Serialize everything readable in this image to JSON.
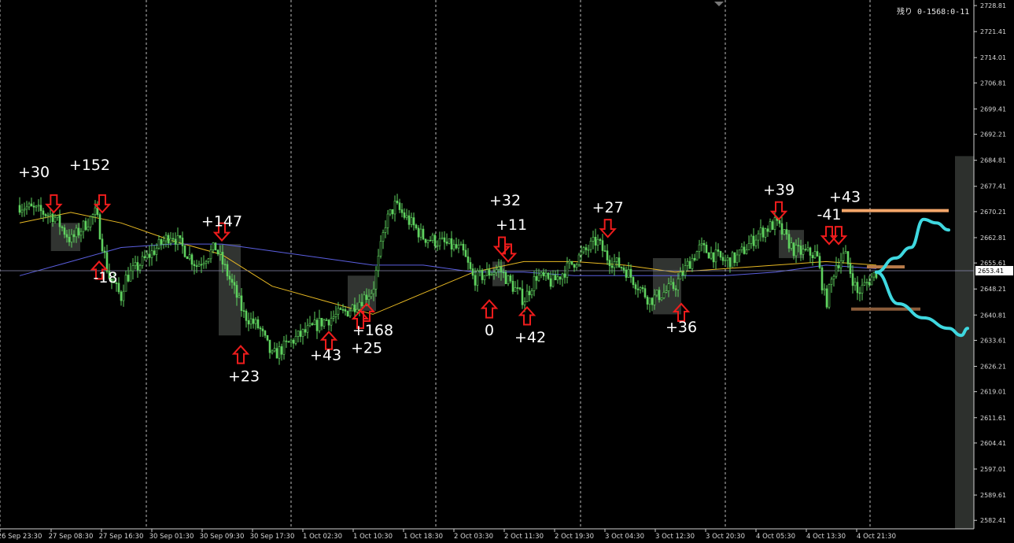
{
  "chart_data": {
    "type": "candlestick",
    "title": "",
    "xlabel": "",
    "ylabel": "",
    "ylim": [
      2580.0,
      2729.5
    ],
    "grid": "vertical-dashed",
    "y_ticks": [
      "2728.81",
      "2721.41",
      "2714.01",
      "2706.81",
      "2699.41",
      "2692.21",
      "2684.81",
      "2677.41",
      "2670.21",
      "2662.81",
      "2655.61",
      "2648.21",
      "2640.81",
      "2633.61",
      "2626.21",
      "2619.01",
      "2611.61",
      "2604.41",
      "2597.01",
      "2589.61",
      "2582.41"
    ],
    "x_ticks": [
      "26 Sep 23:30",
      "27 Sep 08:30",
      "27 Sep 16:30",
      "30 Sep 01:30",
      "30 Sep 09:30",
      "30 Sep 17:30",
      "1 Oct 02:30",
      "1 Oct 10:30",
      "1 Oct 18:30",
      "2 Oct 03:30",
      "2 Oct 11:30",
      "2 Oct 19:30",
      "3 Oct 04:30",
      "3 Oct 12:30",
      "3 Oct 20:30",
      "4 Oct 05:30",
      "4 Oct 13:30",
      "4 Oct 21:30"
    ],
    "current_price": "2653.41",
    "countdown": "残り 0-1568:0-11",
    "price_path": [
      [
        "26 Sep 23:30",
        2672
      ],
      [
        "27 Sep 05:30",
        2669
      ],
      [
        "27 Sep 08:30",
        2662
      ],
      [
        "27 Sep 12:30",
        2670
      ],
      [
        "27 Sep 14:30",
        2652
      ],
      [
        "27 Sep 16:30",
        2646
      ],
      [
        "27 Sep 20:30",
        2651
      ],
      [
        "30 Sep 01:30",
        2664
      ],
      [
        "30 Sep 05:30",
        2655
      ],
      [
        "30 Sep 08:30",
        2660
      ],
      [
        "30 Sep 11:00",
        2650
      ],
      [
        "30 Sep 13:00",
        2641
      ],
      [
        "30 Sep 15:30",
        2637
      ],
      [
        "30 Sep 17:30",
        2629
      ],
      [
        "30 Sep 21:30",
        2634
      ],
      [
        "1 Oct 02:30",
        2639
      ],
      [
        "1 Oct 06:30",
        2642
      ],
      [
        "1 Oct 10:30",
        2648
      ],
      [
        "1 Oct 12:30",
        2667
      ],
      [
        "1 Oct 14:00",
        2672
      ],
      [
        "1 Oct 18:30",
        2663
      ],
      [
        "1 Oct 22:30",
        2661
      ],
      [
        "2 Oct 01:30",
        2659
      ],
      [
        "2 Oct 03:30",
        2651
      ],
      [
        "2 Oct 07:30",
        2654
      ],
      [
        "2 Oct 11:30",
        2645
      ],
      [
        "2 Oct 13:30",
        2652
      ],
      [
        "2 Oct 16:00",
        2650
      ],
      [
        "2 Oct 19:30",
        2656
      ],
      [
        "2 Oct 23:30",
        2662
      ],
      [
        "3 Oct 01:30",
        2657
      ],
      [
        "3 Oct 04:30",
        2654
      ],
      [
        "3 Oct 08:30",
        2645
      ],
      [
        "3 Oct 12:30",
        2649
      ],
      [
        "3 Oct 14:30",
        2655
      ],
      [
        "3 Oct 16:30",
        2660
      ],
      [
        "3 Oct 20:30",
        2656
      ],
      [
        "3 Oct 22:30",
        2657
      ],
      [
        "4 Oct 02:30",
        2664
      ],
      [
        "4 Oct 05:30",
        2667
      ],
      [
        "4 Oct 08:30",
        2659
      ],
      [
        "4 Oct 12:00",
        2658
      ],
      [
        "4 Oct 13:30",
        2644
      ],
      [
        "4 Oct 15:00",
        2655
      ],
      [
        "4 Oct 16:30",
        2658
      ],
      [
        "4 Oct 18:30",
        2647
      ],
      [
        "4 Oct 21:30",
        2653
      ]
    ],
    "series": [
      {
        "name": "",
        "color": "#e8b923",
        "values": [
          [
            "26 Sep 23:30",
            2667
          ],
          [
            "27 Sep 08:30",
            2670
          ],
          [
            "27 Sep 16:30",
            2667
          ],
          [
            "30 Sep 01:30",
            2662
          ],
          [
            "30 Sep 09:30",
            2658
          ],
          [
            "30 Sep 17:30",
            2649
          ],
          [
            "1 Oct 02:30",
            2645
          ],
          [
            "1 Oct 10:30",
            2641
          ],
          [
            "1 Oct 18:30",
            2647
          ],
          [
            "2 Oct 03:30",
            2653
          ],
          [
            "2 Oct 11:30",
            2656
          ],
          [
            "2 Oct 19:30",
            2656
          ],
          [
            "3 Oct 04:30",
            2655
          ],
          [
            "3 Oct 12:30",
            2653
          ],
          [
            "3 Oct 20:30",
            2654
          ],
          [
            "4 Oct 05:30",
            2655
          ],
          [
            "4 Oct 13:30",
            2656
          ],
          [
            "4 Oct 21:30",
            2655
          ]
        ]
      },
      {
        "name": "",
        "color": "#5b5fe0",
        "values": [
          [
            "26 Sep 23:30",
            2652
          ],
          [
            "27 Sep 08:30",
            2656
          ],
          [
            "27 Sep 16:30",
            2660
          ],
          [
            "30 Sep 01:30",
            2661
          ],
          [
            "30 Sep 09:30",
            2661
          ],
          [
            "30 Sep 17:30",
            2659
          ],
          [
            "1 Oct 02:30",
            2657
          ],
          [
            "1 Oct 10:30",
            2655
          ],
          [
            "1 Oct 18:30",
            2655
          ],
          [
            "2 Oct 03:30",
            2653
          ],
          [
            "2 Oct 11:30",
            2653
          ],
          [
            "2 Oct 19:30",
            2652
          ],
          [
            "3 Oct 04:30",
            2652
          ],
          [
            "3 Oct 12:30",
            2652
          ],
          [
            "3 Oct 20:30",
            2652
          ],
          [
            "4 Oct 05:30",
            2653
          ],
          [
            "4 Oct 13:30",
            2655
          ],
          [
            "4 Oct 21:30",
            2654
          ]
        ]
      }
    ],
    "arrows": [
      {
        "dir": "down",
        "x": "27 Sep 05:30",
        "price": 2670
      },
      {
        "dir": "down",
        "x": "27 Sep 13:30",
        "price": 2670
      },
      {
        "dir": "up",
        "x": "27 Sep 13:00",
        "price": 2656
      },
      {
        "dir": "down",
        "x": "30 Sep 09:30",
        "price": 2662
      },
      {
        "dir": "up",
        "x": "30 Sep 12:30",
        "price": 2632
      },
      {
        "dir": "up",
        "x": "1 Oct 03:30",
        "price": 2636
      },
      {
        "dir": "up",
        "x": "1 Oct 08:30",
        "price": 2642
      },
      {
        "dir": "up",
        "x": "1 Oct 09:30",
        "price": 2644
      },
      {
        "dir": "up",
        "x": "2 Oct 06:00",
        "price": 2645
      },
      {
        "dir": "down",
        "x": "2 Oct 08:00",
        "price": 2658
      },
      {
        "dir": "down",
        "x": "2 Oct 09:00",
        "price": 2656
      },
      {
        "dir": "up",
        "x": "2 Oct 12:00",
        "price": 2643
      },
      {
        "dir": "down",
        "x": "3 Oct 01:30",
        "price": 2663
      },
      {
        "dir": "up",
        "x": "3 Oct 13:30",
        "price": 2644
      },
      {
        "dir": "down",
        "x": "4 Oct 06:00",
        "price": 2668
      },
      {
        "dir": "down",
        "x": "4 Oct 14:00",
        "price": 2661
      },
      {
        "dir": "down",
        "x": "4 Oct 15:30",
        "price": 2661
      }
    ],
    "annotations": [
      {
        "text": "+30",
        "x": "27 Sep 02:00",
        "price": 2680
      },
      {
        "text": "+152",
        "x": "27 Sep 11:30",
        "price": 2682
      },
      {
        "text": "-18",
        "x": "27 Sep 14:00",
        "price": 2650
      },
      {
        "text": "+147",
        "x": "30 Sep 09:30",
        "price": 2666
      },
      {
        "text": "+23",
        "x": "30 Sep 13:00",
        "price": 2622
      },
      {
        "text": "+43",
        "x": "1 Oct 03:00",
        "price": 2628
      },
      {
        "text": "+168",
        "x": "1 Oct 10:30",
        "price": 2635
      },
      {
        "text": "+25",
        "x": "1 Oct 09:30",
        "price": 2630
      },
      {
        "text": "+32",
        "x": "2 Oct 08:30",
        "price": 2672
      },
      {
        "text": "+11",
        "x": "2 Oct 09:30",
        "price": 2665
      },
      {
        "text": "0",
        "x": "2 Oct 06:00",
        "price": 2635
      },
      {
        "text": "+42",
        "x": "2 Oct 12:30",
        "price": 2633
      },
      {
        "text": "+27",
        "x": "3 Oct 01:30",
        "price": 2670
      },
      {
        "text": "+36",
        "x": "3 Oct 13:30",
        "price": 2636
      },
      {
        "text": "+39",
        "x": "4 Oct 06:00",
        "price": 2675
      },
      {
        "text": "-41",
        "x": "4 Oct 14:00",
        "price": 2668
      },
      {
        "text": "+43",
        "x": "4 Oct 16:30",
        "price": 2673
      }
    ],
    "zones": [
      {
        "x0": "27 Sep 05:00",
        "x1": "27 Sep 10:00",
        "p0": 2667,
        "p1": 2659
      },
      {
        "x0": "30 Sep 09:00",
        "x1": "30 Sep 12:30",
        "p0": 2661,
        "p1": 2635
      },
      {
        "x0": "1 Oct 06:30",
        "x1": "1 Oct 11:00",
        "p0": 2652,
        "p1": 2642
      },
      {
        "x0": "2 Oct 06:30",
        "x1": "2 Oct 08:30",
        "p0": 2656,
        "p1": 2649
      },
      {
        "x0": "3 Oct 09:00",
        "x1": "3 Oct 13:30",
        "p0": 2657,
        "p1": 2641
      },
      {
        "x0": "4 Oct 06:00",
        "x1": "4 Oct 10:00",
        "p0": 2665,
        "p1": 2657
      }
    ],
    "levels": [
      {
        "price": 2670.5,
        "x0": "4 Oct 16:00",
        "x1": "5 Oct 09:00",
        "color": "#f4a66a"
      },
      {
        "price": 2654.5,
        "x0": "4 Oct 20:00",
        "x1": "5 Oct 02:00",
        "color": "#b87c4a"
      },
      {
        "price": 2642.5,
        "x0": "4 Oct 17:30",
        "x1": "5 Oct 04:30",
        "color": "#8a5c3a"
      }
    ],
    "forecast": {
      "color": "#3fd8e0",
      "start_price": 2653,
      "up": [
        [
          "4 Oct 21:30",
          2653
        ],
        [
          "5 Oct 00:30",
          2657
        ],
        [
          "5 Oct 03:00",
          2660
        ],
        [
          "5 Oct 05:00",
          2668
        ],
        [
          "5 Oct 07:00",
          2667
        ],
        [
          "5 Oct 09:00",
          2665
        ]
      ],
      "down": [
        [
          "4 Oct 21:30",
          2653
        ],
        [
          "5 Oct 01:00",
          2644
        ],
        [
          "5 Oct 05:00",
          2640
        ],
        [
          "5 Oct 09:00",
          2637
        ],
        [
          "5 Oct 11:00",
          2635
        ],
        [
          "5 Oct 12:00",
          2637
        ]
      ]
    },
    "future_zone": {
      "x0": "5 Oct 10:00",
      "x1": "5 Oct 15:00",
      "p0": 2686,
      "p1": 2580
    }
  }
}
